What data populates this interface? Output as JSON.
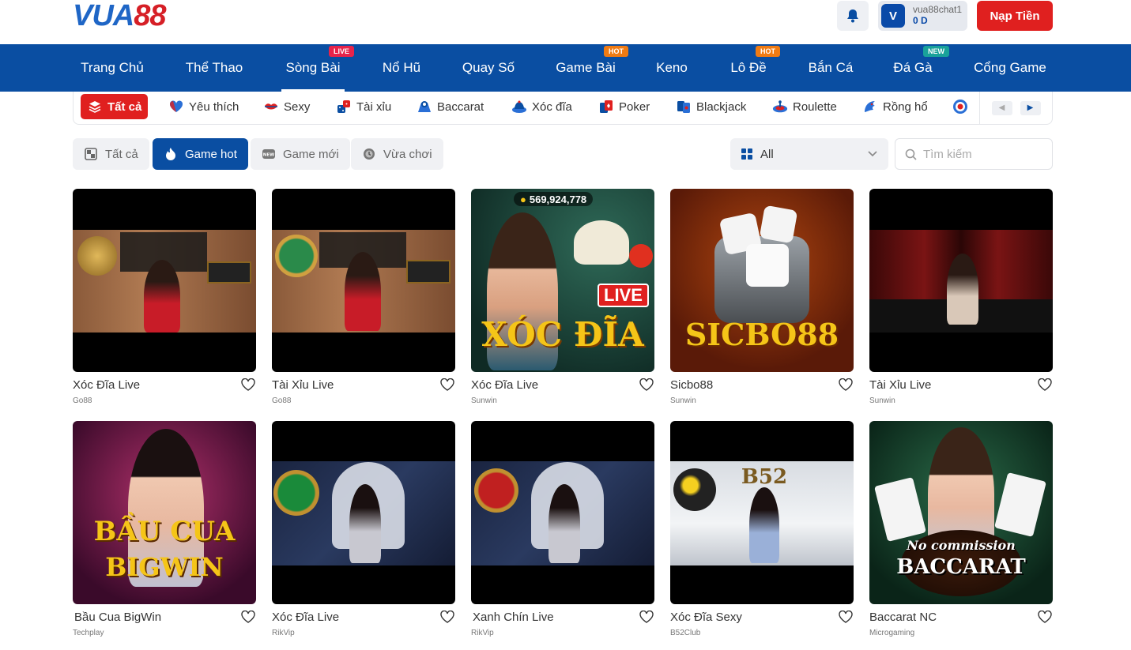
{
  "header": {
    "logo_part1": "VUA",
    "logo_part2": "88",
    "username": "vua88chat1",
    "balance": "0 D",
    "avatar_letter": "V",
    "deposit_label": "Nạp Tiền"
  },
  "nav": [
    {
      "label": "Trang Chủ"
    },
    {
      "label": "Thể Thao"
    },
    {
      "label": "Sòng Bài",
      "badge": "LIVE"
    },
    {
      "label": "Nổ Hũ"
    },
    {
      "label": "Quay Số"
    },
    {
      "label": "Game Bài",
      "badge": "HOT"
    },
    {
      "label": "Keno"
    },
    {
      "label": "Lô Đề",
      "badge": "HOT"
    },
    {
      "label": "Bắn Cá"
    },
    {
      "label": "Đá Gà",
      "badge": "NEW"
    },
    {
      "label": "Cổng Game"
    }
  ],
  "categories": [
    {
      "label": "Tất cả",
      "icon": "layers-icon"
    },
    {
      "label": "Yêu thích",
      "icon": "heart-icon"
    },
    {
      "label": "Sexy",
      "icon": "lips-icon"
    },
    {
      "label": "Tài xỉu",
      "icon": "dice-icon"
    },
    {
      "label": "Baccarat",
      "icon": "baccarat-icon"
    },
    {
      "label": "Xóc đĩa",
      "icon": "xoc-dia-icon"
    },
    {
      "label": "Poker",
      "icon": "poker-cards-icon"
    },
    {
      "label": "Blackjack",
      "icon": "blackjack-icon"
    },
    {
      "label": "Roulette",
      "icon": "roulette-icon"
    },
    {
      "label": "Rồng hổ",
      "icon": "dragon-icon"
    }
  ],
  "filters": {
    "all": "Tất cả",
    "hot": "Game hot",
    "new": "Game mới",
    "recent": "Vừa chơi",
    "provider_selected": "All",
    "search_placeholder": "Tìm kiếm"
  },
  "games": [
    {
      "title": "Xóc Đĩa Live",
      "provider": "Go88"
    },
    {
      "title": "Tài Xỉu Live",
      "provider": "Go88"
    },
    {
      "title": "Xóc Đĩa Live",
      "provider": "Sunwin",
      "jackpot": "569,924,778",
      "art_text": "XÓC ĐĨA",
      "art_tag": "LIVE"
    },
    {
      "title": "Sicbo88",
      "provider": "Sunwin",
      "art_text": "SICBO88"
    },
    {
      "title": "Tài Xỉu Live",
      "provider": "Sunwin"
    },
    {
      "title": "Bầu Cua BigWin",
      "provider": "Techplay",
      "art_text": "BẦU CUA",
      "art_text2": "BIGWIN"
    },
    {
      "title": "Xóc Đĩa Live",
      "provider": "RikVip"
    },
    {
      "title": "Xanh Chín Live",
      "provider": "RikVip"
    },
    {
      "title": "Xóc Đĩa Sexy",
      "provider": "B52Club",
      "art_text": "B52"
    },
    {
      "title": "Baccarat NC",
      "provider": "Microgaming",
      "art_text": "No commission",
      "art_text2": "BACCARAT"
    }
  ],
  "colors": {
    "brand_blue": "#0a4ea2",
    "brand_red": "#e0201f",
    "badge_live": "#e8234a",
    "badge_hot": "#f07b13",
    "badge_new": "#19a29a"
  }
}
